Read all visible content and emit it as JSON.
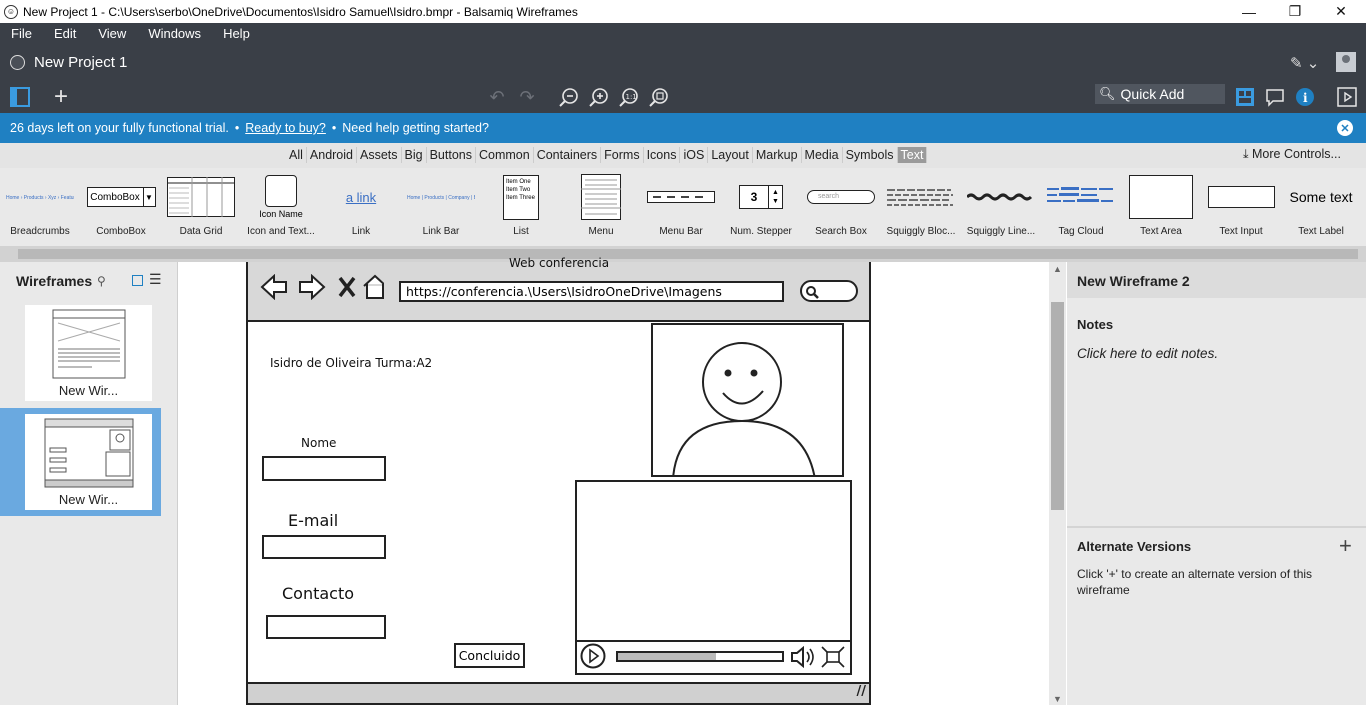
{
  "window": {
    "title": "New Project 1 - C:\\Users\\serbo\\OneDrive\\Documentos\\Isidro Samuel\\Isidro.bmpr - Balsamiq Wireframes",
    "minimize": "—",
    "maximize": "❐",
    "close": "✕"
  },
  "menu": [
    "File",
    "Edit",
    "View",
    "Windows",
    "Help"
  ],
  "project": {
    "title": "New Project 1"
  },
  "toolbar": {
    "quick_add": "Quick Add"
  },
  "trial": {
    "days_left": "26 days left on your fully functional trial.",
    "buy_link": "Ready to buy?",
    "help": "Need help getting started?",
    "bullet": "•"
  },
  "categories": [
    "All",
    "Android",
    "Assets",
    "Big",
    "Buttons",
    "Common",
    "Containers",
    "Forms",
    "Icons",
    "iOS",
    "Layout",
    "Markup",
    "Media",
    "Symbols",
    "Text"
  ],
  "active_category": "Text",
  "more_controls": "More Controls...",
  "library": {
    "items": [
      "Breadcrumbs",
      "ComboBox",
      "Data Grid",
      "Icon and Text...",
      "Link",
      "Link Bar",
      "List",
      "Menu",
      "Menu Bar",
      "Num. Stepper",
      "Search Box",
      "Squiggly Bloc...",
      "Squiggly Line...",
      "Tag Cloud",
      "Text Area",
      "Text Input",
      "Text Label"
    ],
    "combobox_text": "ComboBox",
    "icon_name_text": "Icon Name",
    "link_text": "a link",
    "stepper_value": "3",
    "search_placeholder": "search",
    "text_label_sample": "Some text",
    "list_items": [
      "Item One",
      "Item Two",
      "Item Three"
    ]
  },
  "wireframes_panel": {
    "title": "Wireframes",
    "items": [
      {
        "label": "New Wir..."
      },
      {
        "label": "New Wir..."
      }
    ]
  },
  "canvas": {
    "window_title": "Web conferencia",
    "url": "https://conferencia.\\Users\\IsidroOneDrive\\Imagens",
    "student": "Isidro de Oliveira Turma:A2",
    "fields": [
      {
        "label": "Nome"
      },
      {
        "label": "E-mail"
      },
      {
        "label": "Contacto"
      }
    ],
    "submit": "Concluido"
  },
  "right_panel": {
    "title": "New Wireframe 2",
    "notes_header": "Notes",
    "notes_placeholder": "Click here to edit notes.",
    "alt_header": "Alternate Versions",
    "alt_text": "Click '+' to create an alternate version of this wireframe"
  },
  "colors": {
    "chrome": "#3a3f47",
    "trial_bar": "#1f80c2",
    "selection": "#6aa9e0",
    "panel_bg": "#e9e9e9"
  }
}
